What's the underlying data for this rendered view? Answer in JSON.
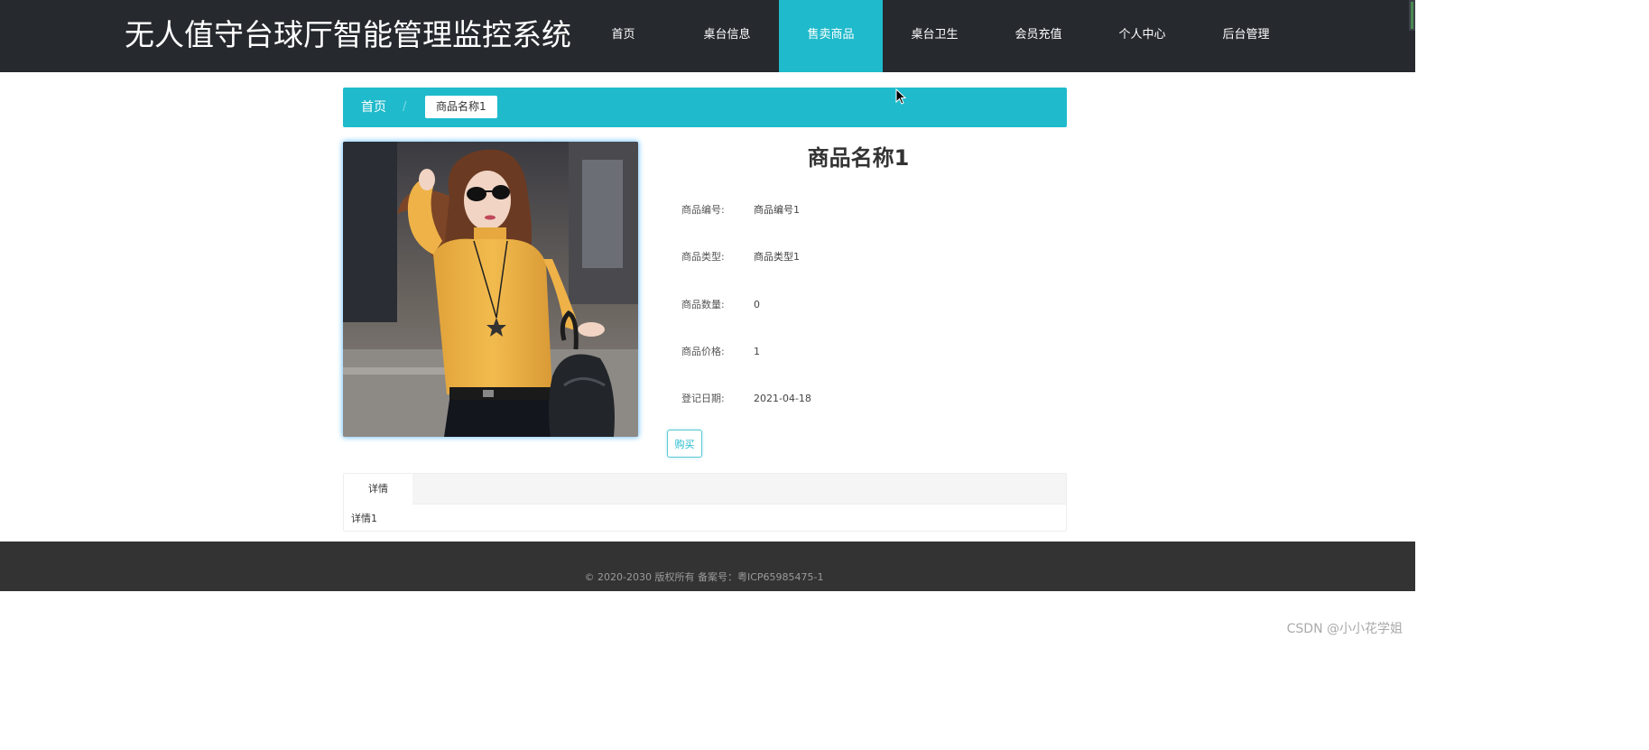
{
  "header": {
    "site_title": "无人值守台球厅智能管理监控系统",
    "nav": [
      {
        "label": "首页",
        "active": false
      },
      {
        "label": "桌台信息",
        "active": false
      },
      {
        "label": "售卖商品",
        "active": true
      },
      {
        "label": "桌台卫生",
        "active": false
      },
      {
        "label": "会员充值",
        "active": false
      },
      {
        "label": "个人中心",
        "active": false
      },
      {
        "label": "后台管理",
        "active": false
      }
    ]
  },
  "breadcrumb": {
    "home": "首页",
    "separator": "/",
    "current": "商品名称1"
  },
  "product": {
    "name": "商品名称1",
    "image_icon": "product-photo",
    "fields": [
      {
        "label": "商品编号:",
        "value": "商品编号1"
      },
      {
        "label": "商品类型:",
        "value": "商品类型1"
      },
      {
        "label": "商品数量:",
        "value": "0"
      },
      {
        "label": "商品价格:",
        "value": "1"
      },
      {
        "label": "登记日期:",
        "value": "2021-04-18"
      }
    ],
    "buy_label": "购买"
  },
  "tabs": {
    "detail_label": "详情",
    "detail_content": "详情1"
  },
  "footer": {
    "copyright": "© 2020-2030 版权所有 备案号：粤ICP65985475-1"
  },
  "watermark": "CSDN @小小花学姐",
  "colors": {
    "accent": "#1fbacb",
    "header_bg": "#262a2f",
    "footer_bg": "#333333"
  }
}
